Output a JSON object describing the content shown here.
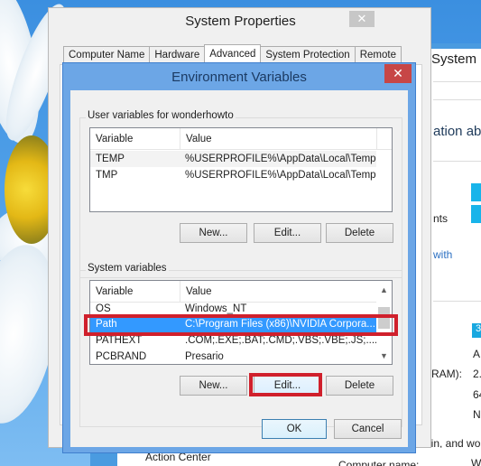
{
  "background_window": {
    "title": "System",
    "heading_fragment": "ation ab",
    "texts": [
      "nts",
      "with",
      "3",
      "A",
      "RAM):",
      "2.",
      "64",
      "N",
      "main, and wo"
    ],
    "bottom_left": "Action Center",
    "bottom_right": "Computer name:",
    "bottom_right_value": "W"
  },
  "system_properties": {
    "title": "System Properties",
    "close_label": "✕",
    "tabs": [
      {
        "label": "Computer Name",
        "active": false
      },
      {
        "label": "Hardware",
        "active": false
      },
      {
        "label": "Advanced",
        "active": true
      },
      {
        "label": "System Protection",
        "active": false
      },
      {
        "label": "Remote",
        "active": false
      }
    ]
  },
  "environment_variables": {
    "title": "Environment Variables",
    "close_label": "✕",
    "user_variables": {
      "label": "User variables for wonderhowto",
      "columns": [
        "Variable",
        "Value"
      ],
      "rows": [
        {
          "variable": "TEMP",
          "value": "%USERPROFILE%\\AppData\\Local\\Temp"
        },
        {
          "variable": "TMP",
          "value": "%USERPROFILE%\\AppData\\Local\\Temp"
        }
      ],
      "buttons": {
        "new": "New...",
        "edit": "Edit...",
        "delete": "Delete"
      }
    },
    "system_variables": {
      "label": "System variables",
      "columns": [
        "Variable",
        "Value"
      ],
      "rows": [
        {
          "variable": "OS",
          "value": "Windows_NT"
        },
        {
          "variable": "Path",
          "value": "C:\\Program Files (x86)\\NVIDIA Corpora...",
          "selected": true
        },
        {
          "variable": "PATHEXT",
          "value": ".COM;.EXE;.BAT;.CMD;.VBS;.VBE;.JS;...."
        },
        {
          "variable": "PCBRAND",
          "value": "Presario"
        }
      ],
      "scroll_up_icon": "▲",
      "scroll_down_icon": "▼",
      "buttons": {
        "new": "New...",
        "edit": "Edit...",
        "delete": "Delete"
      }
    },
    "ok_label": "OK",
    "cancel_label": "Cancel"
  },
  "annotations": {
    "highlight_color": "#d0202c",
    "highlighted": [
      "Path row",
      "System Edit... button"
    ]
  }
}
